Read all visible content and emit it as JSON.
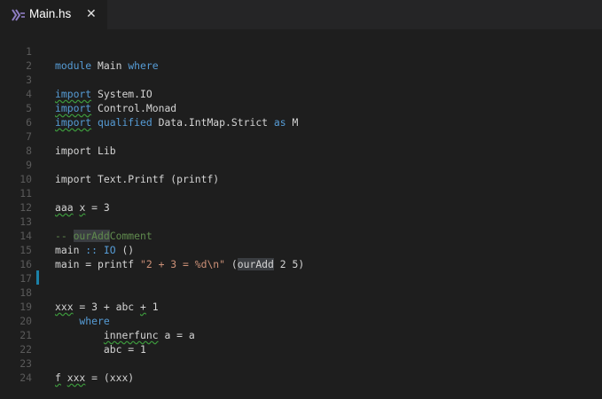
{
  "tab": {
    "label": "Main.hs",
    "close_glyph": "✕",
    "icon": "haskell-icon"
  },
  "lines": [
    {
      "n": "1"
    },
    {
      "n": "2"
    },
    {
      "n": "3"
    },
    {
      "n": "4"
    },
    {
      "n": "5"
    },
    {
      "n": "6"
    },
    {
      "n": "7"
    },
    {
      "n": "8"
    },
    {
      "n": "9"
    },
    {
      "n": "10"
    },
    {
      "n": "11"
    },
    {
      "n": "12"
    },
    {
      "n": "13"
    },
    {
      "n": "14"
    },
    {
      "n": "15"
    },
    {
      "n": "16"
    },
    {
      "n": "17"
    },
    {
      "n": "18"
    },
    {
      "n": "19"
    },
    {
      "n": "20"
    },
    {
      "n": "21"
    },
    {
      "n": "22"
    },
    {
      "n": "23"
    },
    {
      "n": "24"
    }
  ],
  "code": {
    "l1_kw_module": "module",
    "l1_name": " Main ",
    "l1_kw_where": "where",
    "l3_kw": "import",
    "l3_mod": " System.IO",
    "l4_kw": "import",
    "l4_mod": " Control.Monad",
    "l5_kw": "import",
    "l5_qual": " qualified",
    "l5_mod": " Data.IntMap.Strict ",
    "l5_as": "as",
    "l5_alias": " M",
    "l7": "import Lib",
    "l9": "import Text.Printf (printf)",
    "l11_a": "aaa",
    "l11_b": " ",
    "l11_c": "x",
    "l11_d": " = 3",
    "l13_a": "-- ",
    "l13_b": "ourAdd",
    "l13_c": "Comment",
    "l14_a": "main ",
    "l14_b": "::",
    "l14_c": " ",
    "l14_d": "IO",
    "l14_e": " ()",
    "l15_a": "main = printf ",
    "l15_b": "\"2 + 3 = %d\\n\"",
    "l15_c": " (",
    "l15_d": "ourAdd",
    "l15_e": " 2 5)",
    "l18_a": "xxx",
    "l18_b": " = 3 + abc ",
    "l18_c": "+",
    "l18_d": " 1",
    "l19": "    where",
    "l20_a": "        ",
    "l20_b": "innerfunc",
    "l20_c": " a = a",
    "l21": "        abc = 1",
    "l23_a": "f",
    "l23_b": " ",
    "l23_c": "xxx",
    "l23_d": " = (xxx)"
  },
  "colors": {
    "background": "#1e1e1e",
    "keyword": "#569cd6",
    "string": "#ce9178",
    "comment": "#608b4e",
    "text": "#d4d4d4",
    "line_number": "#5a5a5a",
    "squiggle": "#3d9b3d",
    "modified_bar": "#1b81a8"
  }
}
